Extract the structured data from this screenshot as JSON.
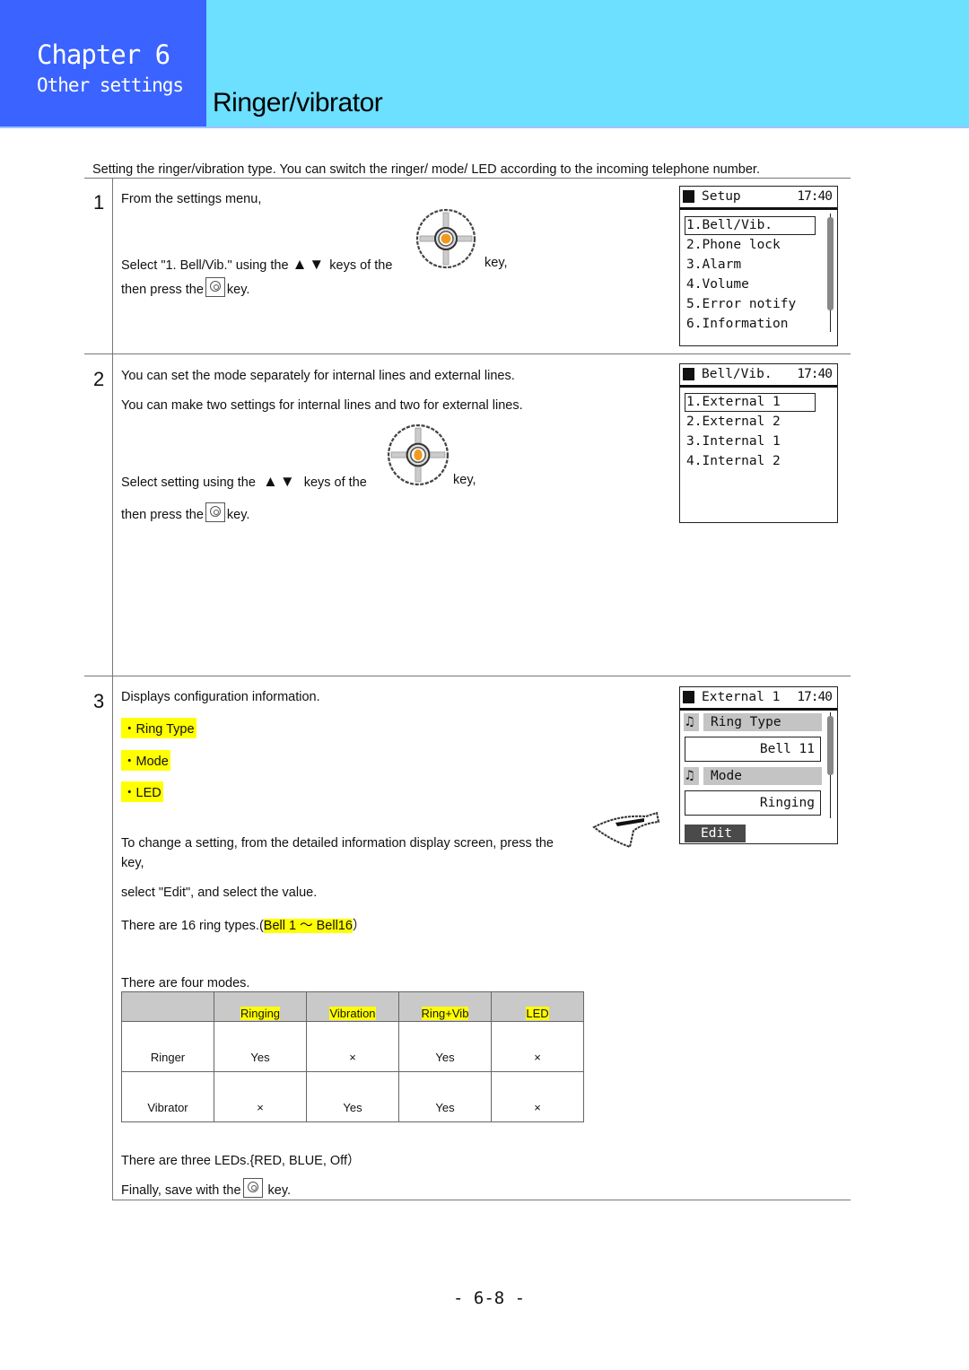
{
  "header": {
    "chapter": "Chapter 6",
    "chapter_subtitle": "Other settings",
    "title": "Ringer/vibrator",
    "colors": {
      "chapter_bg": "#3a63ff",
      "title_bg": "#6ddfff",
      "highlight": "#ffff00"
    }
  },
  "intro": "Setting the ringer/vibration type. You can switch the ringer/ mode/ LED according to the incoming telephone number.",
  "steps": [
    {
      "number": "1",
      "lines": {
        "l1": "From the settings menu,",
        "l2_a": "Select \"1. Bell/Vib.\" using the",
        "l2_b": "keys of the",
        "l2_c": "key,",
        "l3_a": "then press the",
        "l3_b": "key."
      },
      "screen": {
        "title": "Setup",
        "time": "17:40",
        "items": [
          "1.Bell/Vib.",
          "2.Phone lock",
          "3.Alarm",
          "4.Volume",
          "5.Error notify",
          "6.Information"
        ],
        "selected_index": 0
      }
    },
    {
      "number": "2",
      "lines": {
        "l1": "You can set the mode separately for internal lines and external lines.",
        "l2": "You can make two settings for internal lines and two for external lines.",
        "l3_a": "Select setting using the",
        "l3_b": "keys of the",
        "l3_c": "key,",
        "l4_a": "then press the",
        "l4_b": "key."
      },
      "screen": {
        "title": "Bell/Vib.",
        "time": "17:40",
        "items": [
          "1.External 1",
          "2.External 2",
          "3.Internal 1",
          "4.Internal 2"
        ],
        "selected_index": 0
      }
    },
    {
      "number": "3",
      "lines": {
        "l1": "Displays configuration information.",
        "bullets": [
          "・Ring Type",
          "・Mode",
          "・LED"
        ],
        "change_a": "To change a setting, from the detailed information display screen, press the",
        "change_b": "key,",
        "select_edit": "select \"Edit\", and select the value.",
        "ring_types_a": "There are 16 ring types.(",
        "ring_types_hl": "Bell 1 ～ Bell16",
        "ring_types_b": "）",
        "four_modes": "There are four modes.",
        "leds": "There are three LEDs.{RED, BLUE, Off）",
        "save_a": "Finally, save with the",
        "save_b": "key."
      },
      "modes_table": {
        "headers": [
          "",
          "Ringing",
          "Vibration",
          "Ring+Vib",
          "LED"
        ],
        "rows": [
          [
            "Ringer",
            "Yes",
            "×",
            "Yes",
            "×"
          ],
          [
            "Vibrator",
            "×",
            "Yes",
            "Yes",
            "×"
          ]
        ]
      },
      "screen": {
        "title": "External 1",
        "time": "17:40",
        "field1_label": "Ring Type",
        "field1_value": "Bell 11",
        "field2_label": "Mode",
        "field2_value": "Ringing",
        "softkey": "Edit"
      }
    }
  ],
  "icons": {
    "updown": "▲▼",
    "dpad": "navigation-dpad-icon",
    "ok": "ok-key-icon",
    "softkey": "left-softkey-icon"
  },
  "page_number": "- 6-8 -"
}
